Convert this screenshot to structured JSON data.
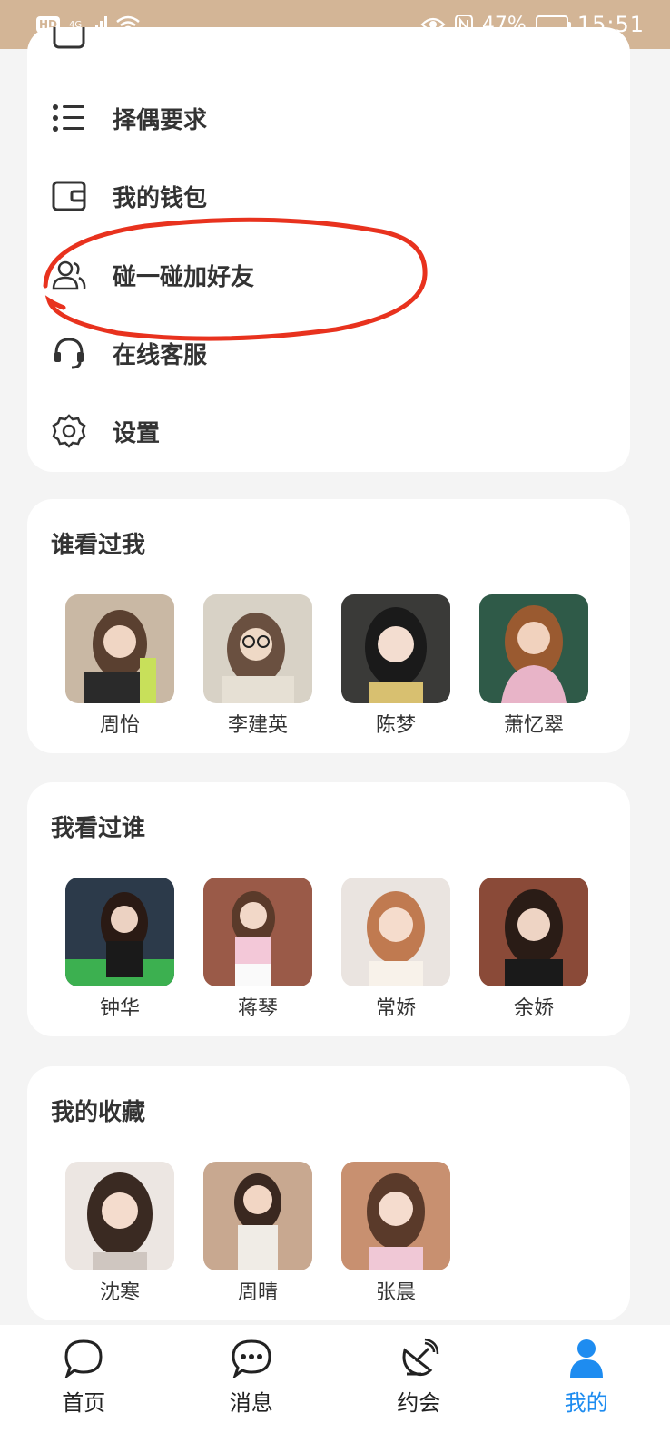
{
  "status_bar": {
    "hd": "HD",
    "network": "4G",
    "battery": "47%",
    "battery_level": 0.47,
    "time": "15:51"
  },
  "menu": {
    "items": [
      {
        "label": "择偶要求",
        "icon": "list-icon"
      },
      {
        "label": "我的钱包",
        "icon": "wallet-icon"
      },
      {
        "label": "碰一碰加好友",
        "icon": "users-icon"
      },
      {
        "label": "在线客服",
        "icon": "headset-icon"
      },
      {
        "label": "设置",
        "icon": "gear-icon"
      }
    ]
  },
  "sections": [
    {
      "title": "谁看过我",
      "profiles": [
        {
          "name": "周怡"
        },
        {
          "name": "李建英"
        },
        {
          "name": "陈梦"
        },
        {
          "name": "萧忆翠"
        }
      ]
    },
    {
      "title": "我看过谁",
      "profiles": [
        {
          "name": "钟华"
        },
        {
          "name": "蒋琴"
        },
        {
          "name": "常娇"
        },
        {
          "name": "余娇"
        }
      ]
    },
    {
      "title": "我的收藏",
      "profiles": [
        {
          "name": "沈寒"
        },
        {
          "name": "周晴"
        },
        {
          "name": "张晨"
        }
      ]
    }
  ],
  "bottom_nav": {
    "items": [
      {
        "label": "首页",
        "icon": "chat-bubble-icon"
      },
      {
        "label": "消息",
        "icon": "message-icon"
      },
      {
        "label": "约会",
        "icon": "satellite-icon"
      },
      {
        "label": "我的",
        "icon": "person-icon",
        "active": true
      }
    ]
  },
  "colors": {
    "status_bar": "#d3b596",
    "accent": "#1e8cf0",
    "annotation": "#e8321e"
  }
}
